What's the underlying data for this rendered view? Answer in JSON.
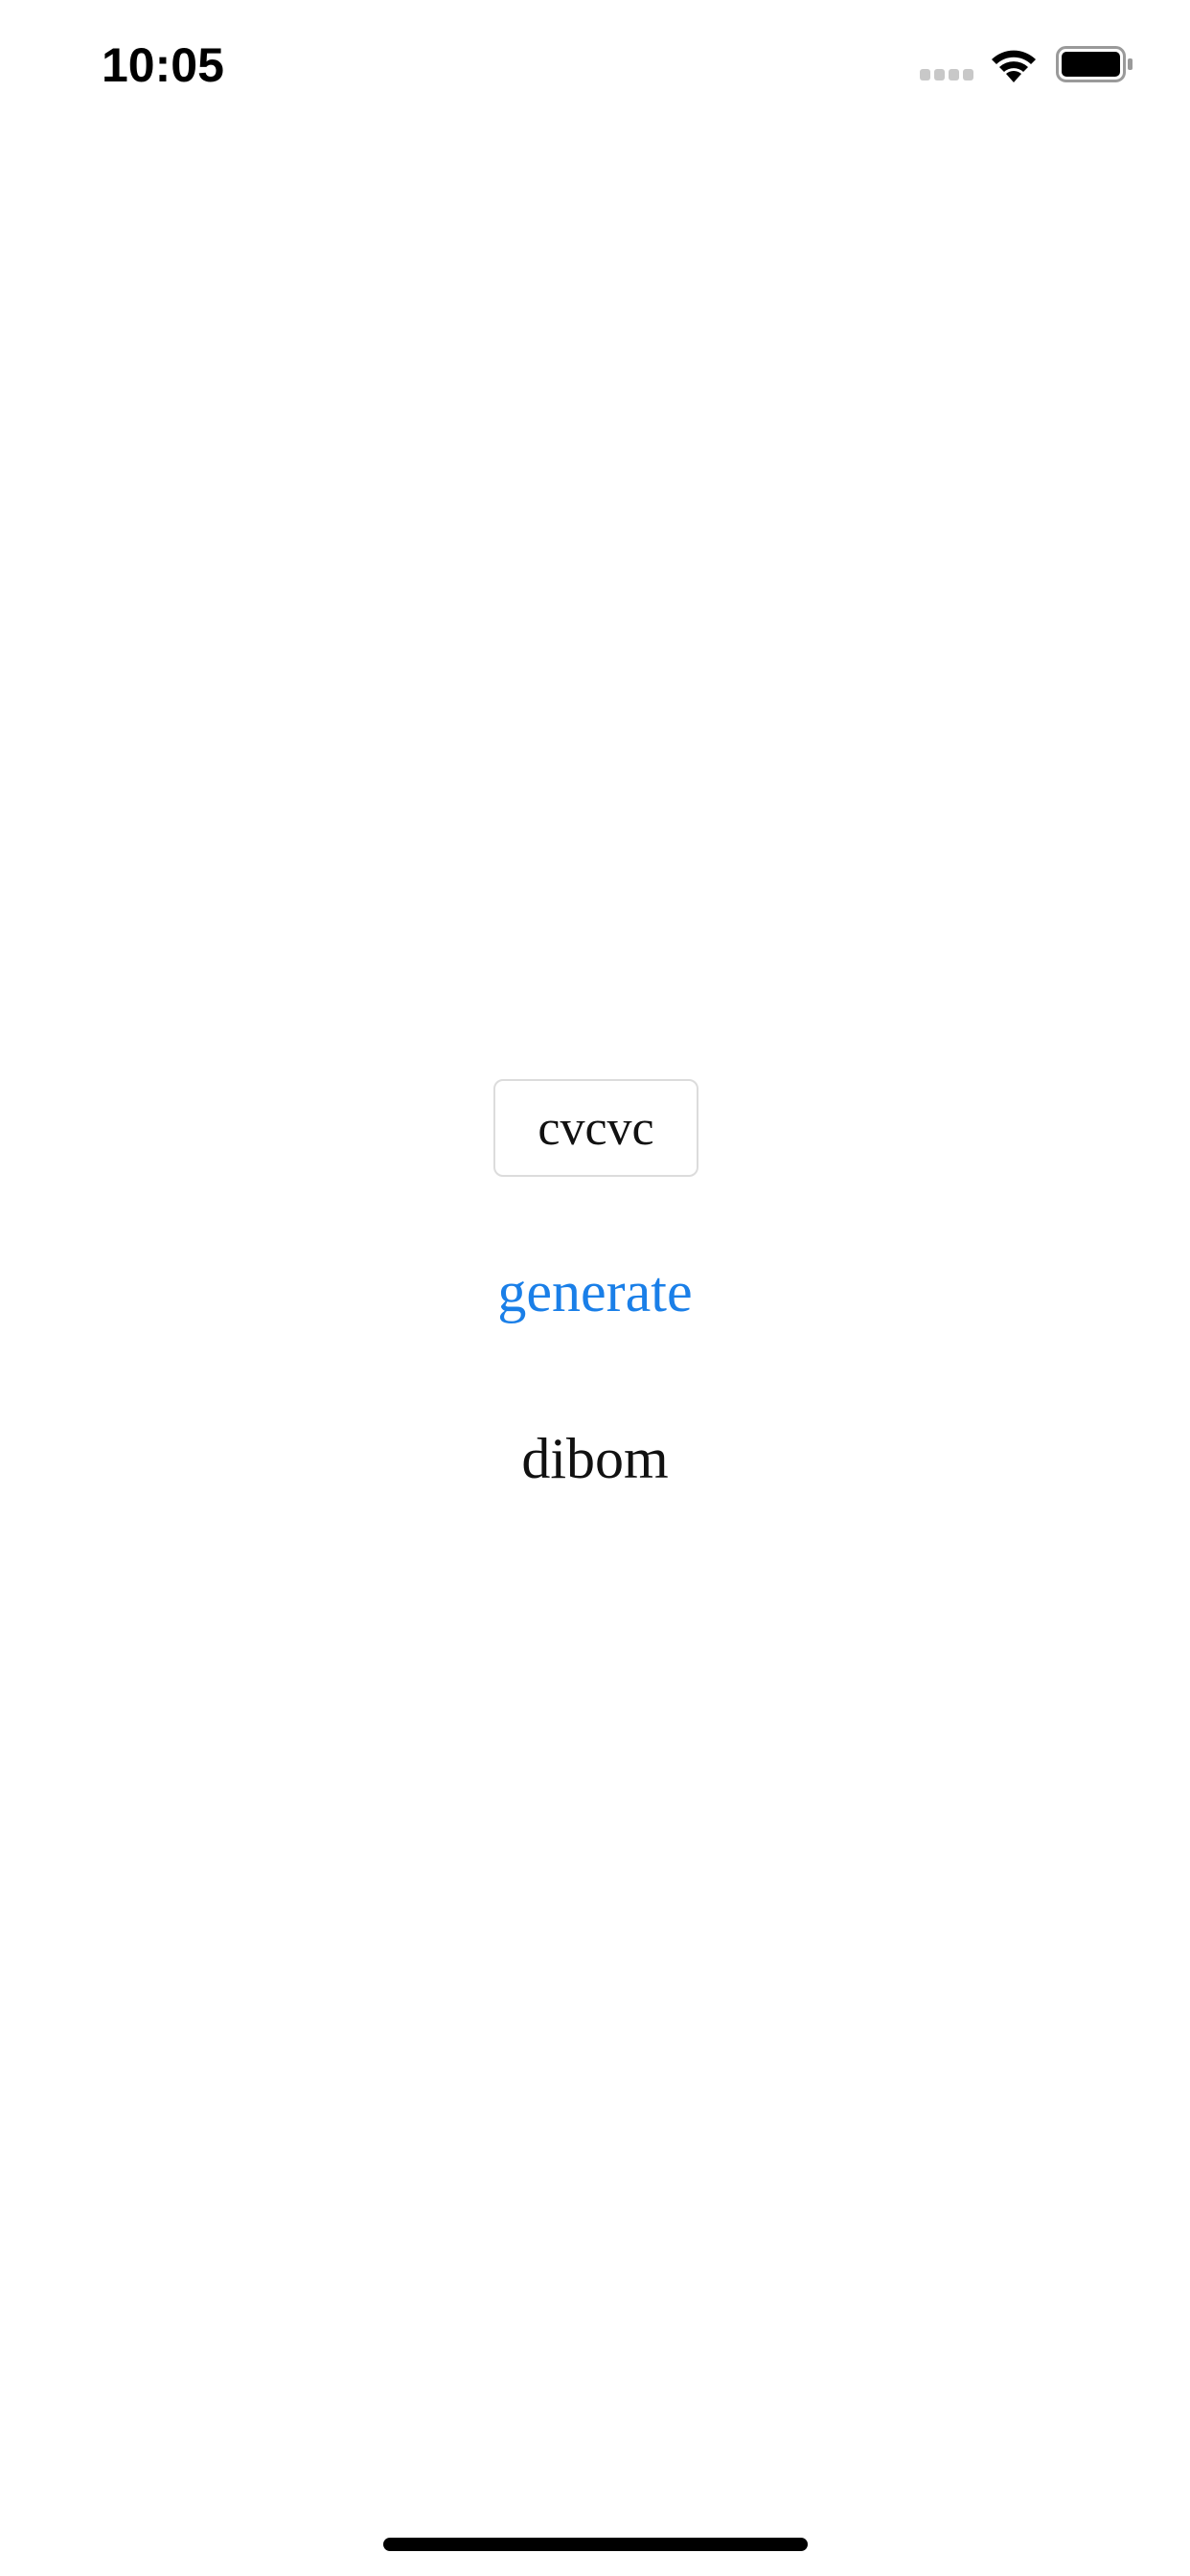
{
  "status_bar": {
    "time": "10:05",
    "signal_icon": "cellular-signal-icon",
    "wifi_icon": "wifi-icon",
    "battery_icon": "battery-icon"
  },
  "main": {
    "pattern_input": {
      "value": "cvcvc"
    },
    "generate_label": "generate",
    "result": "dibom"
  },
  "colors": {
    "accent": "#1a7fe8",
    "text": "#111111",
    "field_border": "#dcdcdc",
    "background": "#ffffff"
  }
}
